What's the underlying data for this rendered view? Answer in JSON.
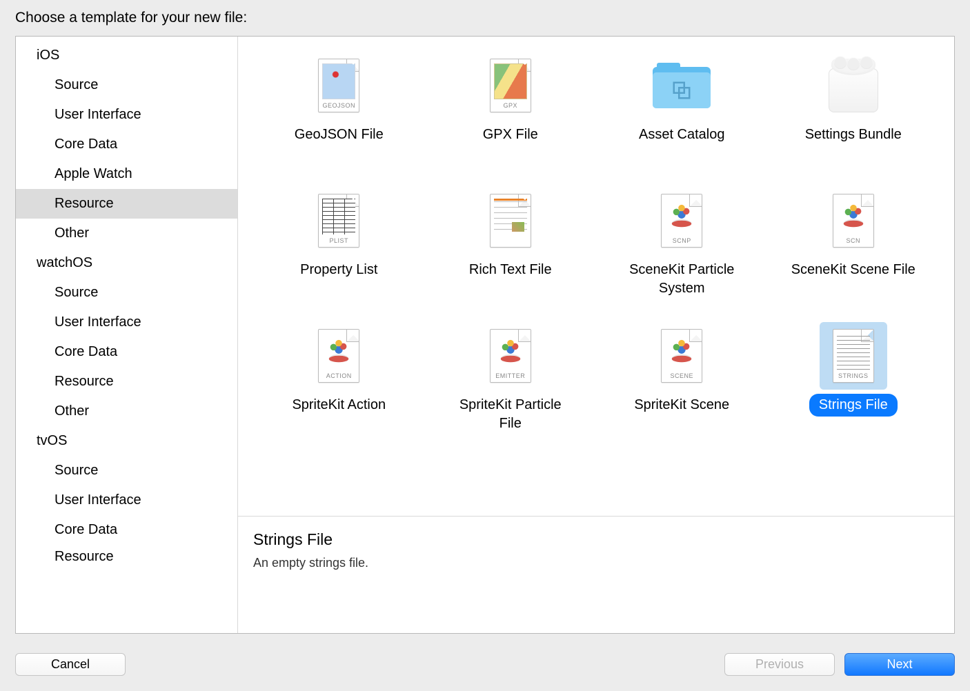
{
  "header": {
    "title": "Choose a template for your new file:"
  },
  "sidebar": {
    "groups": [
      {
        "name": "iOS",
        "items": [
          {
            "label": "Source"
          },
          {
            "label": "User Interface"
          },
          {
            "label": "Core Data"
          },
          {
            "label": "Apple Watch"
          },
          {
            "label": "Resource",
            "selected": true
          },
          {
            "label": "Other"
          }
        ]
      },
      {
        "name": "watchOS",
        "items": [
          {
            "label": "Source"
          },
          {
            "label": "User Interface"
          },
          {
            "label": "Core Data"
          },
          {
            "label": "Resource"
          },
          {
            "label": "Other"
          }
        ]
      },
      {
        "name": "tvOS",
        "items": [
          {
            "label": "Source"
          },
          {
            "label": "User Interface"
          },
          {
            "label": "Core Data"
          },
          {
            "label": "Resource"
          }
        ]
      }
    ]
  },
  "templates": [
    {
      "label": "GeoJSON File",
      "icon": "geojson",
      "tag": "GEOJSON"
    },
    {
      "label": "GPX File",
      "icon": "gpx",
      "tag": "GPX"
    },
    {
      "label": "Asset Catalog",
      "icon": "folder"
    },
    {
      "label": "Settings Bundle",
      "icon": "bundle"
    },
    {
      "label": "Property List",
      "icon": "plist",
      "tag": "PLIST"
    },
    {
      "label": "Rich Text File",
      "icon": "rtf"
    },
    {
      "label": "SceneKit Particle System",
      "icon": "skdots",
      "tag": "SCNP"
    },
    {
      "label": "SceneKit Scene File",
      "icon": "skdots",
      "tag": "SCN"
    },
    {
      "label": "SpriteKit Action",
      "icon": "skdots",
      "tag": "ACTION"
    },
    {
      "label": "SpriteKit Particle File",
      "icon": "skdots",
      "tag": "EMITTER"
    },
    {
      "label": "SpriteKit Scene",
      "icon": "skdots",
      "tag": "SCENE"
    },
    {
      "label": "Strings File",
      "icon": "strings",
      "tag": "STRINGS",
      "selected": true
    }
  ],
  "detail": {
    "title": "Strings File",
    "description": "An empty strings file."
  },
  "buttons": {
    "cancel": "Cancel",
    "previous": "Previous",
    "next": "Next"
  }
}
